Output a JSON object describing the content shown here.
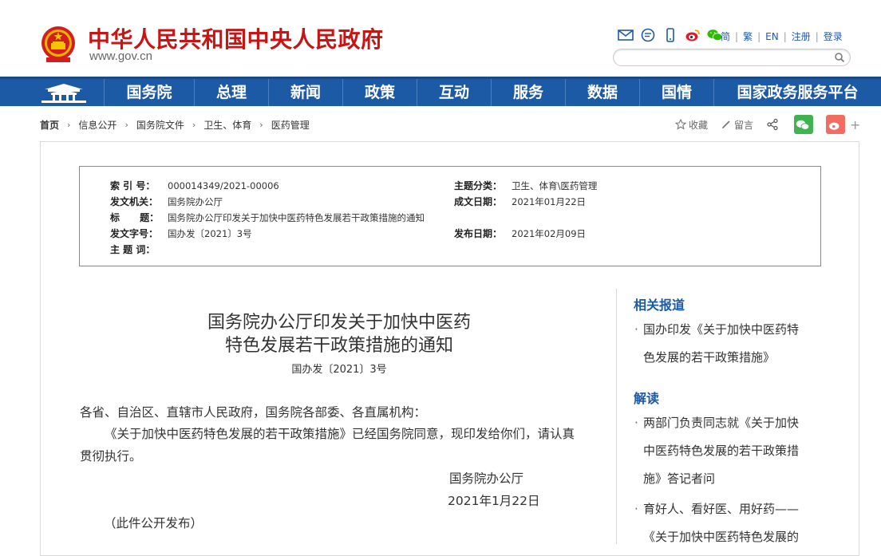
{
  "header": {
    "site_title": "中华人民共和国中央人民政府",
    "site_url": "www.gov.cn",
    "lang_links": [
      "简",
      "繁",
      "EN",
      "注册",
      "登录"
    ],
    "search_placeholder": ""
  },
  "nav": {
    "items": [
      "国务院",
      "总理",
      "新闻",
      "政策",
      "互动",
      "服务",
      "数据",
      "国情",
      "国家政务服务平台"
    ]
  },
  "breadcrumb": [
    "首页",
    "信息公开",
    "国务院文件",
    "卫生、体育",
    "医药管理"
  ],
  "share": {
    "favorite": "收藏",
    "comment": "留言"
  },
  "meta": {
    "index_label": "索 引 号：",
    "index_value": "000014349/2021-00006",
    "topic_label": "主题分类：",
    "topic_value": "卫生、体育\\医药管理",
    "issuer_label": "发文机关：",
    "issuer_value": "国务院办公厅",
    "created_label": "成文日期：",
    "created_value": "2021年01月22日",
    "title_label": "标      题：",
    "title_value": "国务院办公厅印发关于加快中医药特色发展若干政策措施的通知",
    "docno_label": "发文字号：",
    "docno_value": "国办发〔2021〕3号",
    "published_label": "发布日期：",
    "published_value": "2021年02月09日",
    "keywords_label": "主 题 词：",
    "keywords_value": ""
  },
  "document": {
    "title_line1": "国务院办公厅印发关于加快中医药",
    "title_line2": "特色发展若干政策措施的通知",
    "doc_number": "国办发〔2021〕3号",
    "salutation": "各省、自治区、直辖市人民政府，国务院各部委、各直属机构：",
    "para1_line1": "《关于加快中医药特色发展的若干政策措施》已经国务院同意，现印发给你们，请认真",
    "para1_line2": "贯彻执行。",
    "signature": "国务院办公厅",
    "date": "2021年1月22日",
    "note": "（此件公开发布）"
  },
  "sidebar": {
    "related_heading": "相关报道",
    "related_items": [
      [
        "国办印发《关于加快中医药特",
        "色发展的若干政策措施》"
      ]
    ],
    "interpret_heading": "解读",
    "interpret_items": [
      [
        "两部门负责同志就《关于加快",
        "中医药特色发展的若干政策措",
        "施》答记者问"
      ],
      [
        "育好人、看好医、用好药——",
        "《关于加快中医药特色发展的"
      ]
    ]
  },
  "colors": {
    "brand_red": "#c71414",
    "nav_blue": "#1c5aa5"
  }
}
